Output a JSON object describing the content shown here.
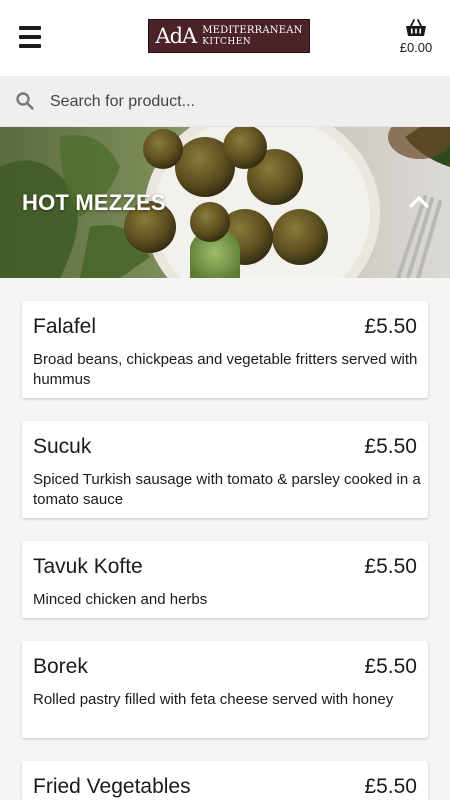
{
  "header": {
    "logo": {
      "mark": "AdA",
      "line1": "MEDITERRANEAN",
      "line2": "KITCHEN"
    },
    "basket_total": "£0.00"
  },
  "icons": [
    "menu-icon",
    "basket-icon",
    "search-icon",
    "chevron-up-icon"
  ],
  "search": {
    "placeholder": "Search for product..."
  },
  "category": {
    "title": "HOT MEZZES"
  },
  "products": [
    {
      "name": "Falafel",
      "price": "£5.50",
      "description": "Broad beans, chickpeas and vegetable fritters served with hummus"
    },
    {
      "name": "Sucuk",
      "price": "£5.50",
      "description": "Spiced Turkish sausage with tomato & parsley cooked in a tomato sauce"
    },
    {
      "name": "Tavuk Kofte",
      "price": "£5.50",
      "description": "Minced chicken and herbs"
    },
    {
      "name": "Borek",
      "price": "£5.50",
      "description": "Rolled pastry filled with feta cheese served with honey"
    },
    {
      "name": "Fried Vegetables",
      "price": "£5.50",
      "description": ""
    }
  ],
  "colors": {
    "brand": "#4a2227",
    "background": "#f5f5f5",
    "card": "#ffffff",
    "text": "#1b1b1b"
  }
}
